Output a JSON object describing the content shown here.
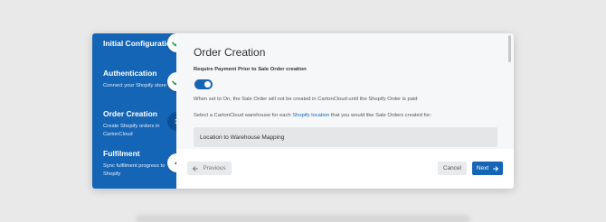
{
  "steps": [
    {
      "title": "Initial Configuration",
      "description": "",
      "status": "complete",
      "marker": "check-icon"
    },
    {
      "title": "Authentication",
      "description": "Connect your Shopify store",
      "status": "complete",
      "marker": "check-icon"
    },
    {
      "title": "Order Creation",
      "description": "Create Shopify orders in CartonCloud",
      "status": "current",
      "marker": "3"
    },
    {
      "title": "Fulfilment",
      "description": "Sync fulfilment progress to Shopify",
      "status": "upcoming",
      "marker": "4"
    }
  ],
  "main": {
    "heading": "Order Creation",
    "payment_label": "Require Payment Prior to Sale Order creation",
    "payment_toggle": true,
    "payment_help": "When set to On, the Sale Order will not be created in CartonCloud until the Shopify Order is paid",
    "warehouse_text_before": "Select a CartonCloud warehouse for each ",
    "warehouse_link": "Shopify location",
    "warehouse_text_after": " that you would like Sale Orders created for:",
    "mapping_header": "Location to Warehouse Mapping"
  },
  "footer": {
    "previous_label": "Previous",
    "cancel_label": "Cancel",
    "next_label": "Next"
  },
  "colors": {
    "sidebar": "#1565b7",
    "accent": "#1565b7",
    "check": "#2fa060"
  }
}
